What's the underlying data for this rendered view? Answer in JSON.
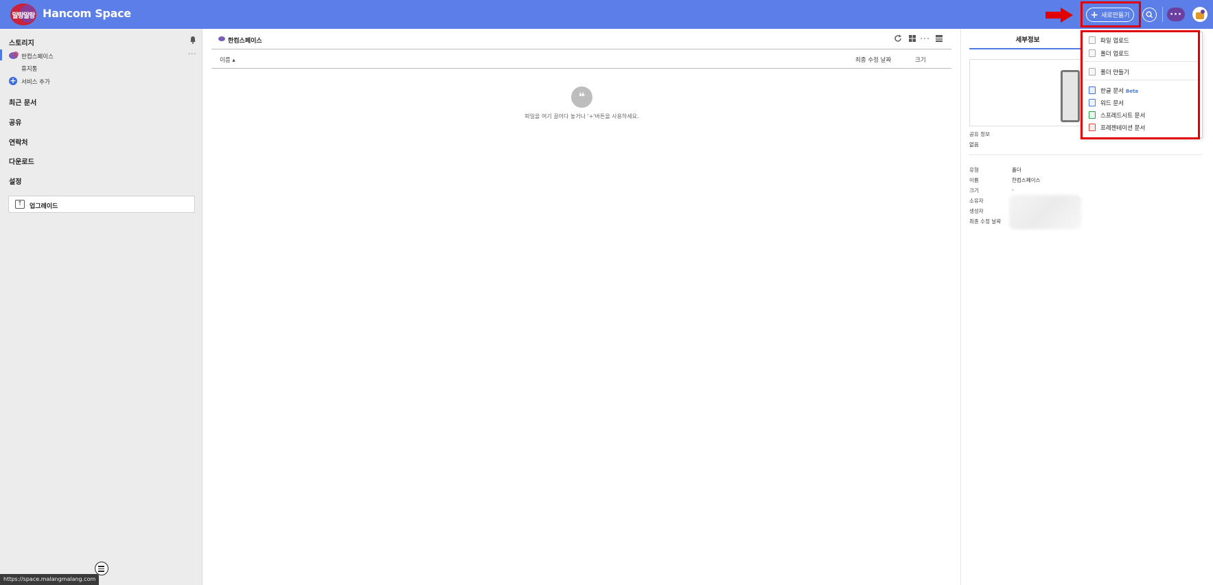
{
  "header": {
    "logo_text": "말랑말랑",
    "app_title": "Hancom Space",
    "new_button_label": "새로만들기",
    "more_label": "···"
  },
  "sidebar": {
    "storage_title": "스토리지",
    "space_item": "한컴스페이스",
    "trash_item": "휴지통",
    "add_service": "서비스 추가",
    "recent_docs": "최근 문서",
    "share": "공유",
    "contacts": "연락처",
    "downloads": "다운로드",
    "settings": "설정",
    "upgrade": "업그레이드",
    "item_more": "···"
  },
  "main": {
    "title": "한컴스페이스",
    "columns": {
      "name": "이름 ▴",
      "modified": "최종 수정 날짜",
      "size": "크기"
    },
    "empty_text": "파일을 여기 끌어다 놓거나 '+'버튼을 사용하세요.",
    "empty_icon_glyph": "❝"
  },
  "details": {
    "tab_label": "세부정보",
    "share_info_label": "공유 정보",
    "share_info_value": "없음",
    "fields": [
      {
        "label": "유형",
        "value": "폴더"
      },
      {
        "label": "이름",
        "value": "한컴스페이스"
      },
      {
        "label": "크기",
        "value": "-"
      },
      {
        "label": "소유자",
        "value": ""
      },
      {
        "label": "생성자",
        "value": ""
      },
      {
        "label": "최종 수정 날짜",
        "value": ""
      }
    ]
  },
  "dropdown": {
    "items": [
      {
        "label": "파일 업로드",
        "icon": "file-upload-icon"
      },
      {
        "label": "폴더 업로드",
        "icon": "folder-upload-icon"
      },
      {
        "label": "폴더 만들기",
        "icon": "folder-create-icon"
      },
      {
        "label": "한글 문서",
        "icon": "hwp-doc-icon",
        "badge": "Beta"
      },
      {
        "label": "워드 문서",
        "icon": "word-doc-icon"
      },
      {
        "label": "스프레드시트 문서",
        "icon": "spreadsheet-doc-icon"
      },
      {
        "label": "프레젠테이션 문서",
        "icon": "presentation-doc-icon"
      }
    ]
  },
  "status_bar": {
    "url": "https://space.malangmalang.com"
  },
  "colors": {
    "header_bg": "#5b7fe6",
    "accent": "#4b7be0",
    "highlight_red": "#e00000",
    "sidebar_bg": "#ececec"
  }
}
